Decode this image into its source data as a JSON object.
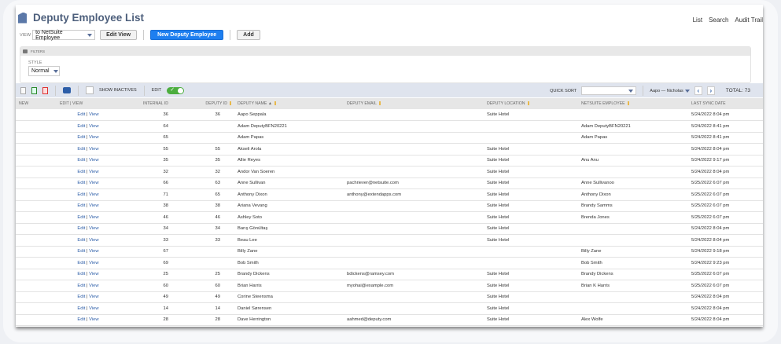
{
  "header": {
    "title": "Deputy Employee List",
    "links": [
      "List",
      "Search",
      "Audit Trail"
    ]
  },
  "view": {
    "label": "VIEW",
    "selected": "to NetSuite Employee",
    "edit_view": "Edit View",
    "new_button": "New Deputy Employee",
    "add_button": "Add"
  },
  "filters": {
    "label": "FILTERS",
    "style_label": "STYLE",
    "style_value": "Normal"
  },
  "toolbar": {
    "show_inactives": "SHOW INACTIVES",
    "edit_label": "EDIT",
    "edit_on": true,
    "quick_sort_label": "QUICK SORT",
    "quick_sort_value": "",
    "range": "Aapo — Nicholas",
    "total": "TOTAL: 73"
  },
  "columns": [
    "NEW",
    "EDIT | VIEW",
    "INTERNAL ID",
    "DEPUTY ID",
    "DEPUTY NAME ▲",
    "DEPUTY EMAIL",
    "DEPUTY LOCATION",
    "NETSUITE EMPLOYEE",
    "LAST SYNC DATE"
  ],
  "link_edit": "Edit",
  "link_sep": " | ",
  "link_view": "View",
  "rows": [
    [
      "36",
      "36",
      "Aapo Seppala",
      "",
      "Suite Hotel",
      "",
      "5/24/2022 8:04 pm"
    ],
    [
      "64",
      "",
      "Adam DeputyBFN20221",
      "",
      "",
      "Adam DeputyBFN20221",
      "5/24/2022 8:41 pm"
    ],
    [
      "65",
      "",
      "Adam Papas",
      "",
      "",
      "Adam Papas",
      "5/24/2022 8:41 pm"
    ],
    [
      "55",
      "55",
      "Akseli Arola",
      "",
      "Suite Hotel",
      "",
      "5/24/2022 8:04 pm"
    ],
    [
      "35",
      "35",
      "Allie Reyes",
      "",
      "Suite Hotel",
      "Anu Anu",
      "5/24/2022 9:17 pm"
    ],
    [
      "32",
      "32",
      "Andor Van Soeren",
      "",
      "Suite Hotel",
      "",
      "5/24/2022 8:04 pm"
    ],
    [
      "66",
      "63",
      "Anne Sullivan",
      "pachriever@netsuite.com",
      "Suite Hotel",
      "Anne Sullivanoo",
      "5/25/2022 6:07 pm"
    ],
    [
      "71",
      "65",
      "Anthony Dixon",
      "anthony@extendapps.com",
      "Suite Hotel",
      "Anthony Dixon",
      "5/25/2022 6:07 pm"
    ],
    [
      "38",
      "38",
      "Ariana Vevang",
      "",
      "Suite Hotel",
      "Brandy Samms",
      "5/25/2022 6:07 pm"
    ],
    [
      "46",
      "46",
      "Ashley Soto",
      "",
      "Suite Hotel",
      "Brenda Jones",
      "5/25/2022 6:07 pm"
    ],
    [
      "34",
      "34",
      "Barış Gönültaş",
      "",
      "Suite Hotel",
      "",
      "5/24/2022 8:04 pm"
    ],
    [
      "33",
      "33",
      "Beau Lee",
      "",
      "Suite Hotel",
      "",
      "5/24/2022 8:04 pm"
    ],
    [
      "67",
      "",
      "Billy Zane",
      "",
      "",
      "Billy Zane",
      "5/24/2022 9:18 pm"
    ],
    [
      "69",
      "",
      "Bob Smith",
      "",
      "",
      "Bob Smith",
      "5/24/2022 9:23 pm"
    ],
    [
      "25",
      "25",
      "Brandy Dickens",
      "bdickens@ramsey.com",
      "Suite Hotel",
      "Brandy Dickens",
      "5/25/2022 6:07 pm"
    ],
    [
      "60",
      "60",
      "Brian Harris",
      "myohai@example.com",
      "Suite Hotel",
      "Brian K Harris",
      "5/25/2022 6:07 pm"
    ],
    [
      "49",
      "49",
      "Corine Steensma",
      "",
      "Suite Hotel",
      "",
      "5/24/2022 8:04 pm"
    ],
    [
      "14",
      "14",
      "Daniel Sørensen",
      "",
      "Suite Hotel",
      "",
      "5/24/2022 8:04 pm"
    ],
    [
      "28",
      "28",
      "Dave Herrington",
      "aahmed@deputy.com",
      "Suite Hotel",
      "Alex Wolfe",
      "5/24/2022 8:04 pm"
    ]
  ]
}
